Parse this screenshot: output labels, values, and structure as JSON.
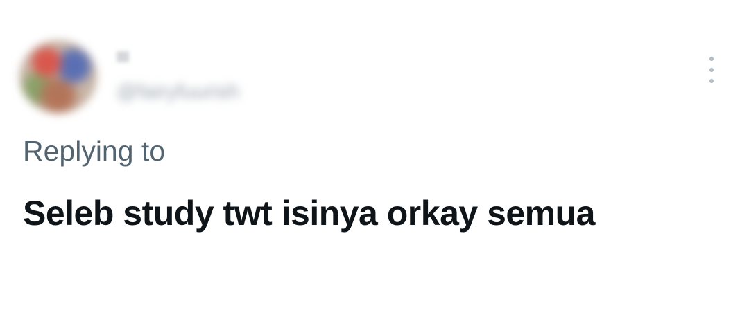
{
  "user": {
    "display_name": "",
    "handle": "@fairyfuurish"
  },
  "icons": {
    "avatar": "profile-avatar",
    "more": "more-vertical-icon"
  },
  "reply": {
    "label": "Replying to"
  },
  "tweet": {
    "text": "Seleb study twt isinya orkay semua"
  },
  "colors": {
    "text_primary": "#0f1419",
    "text_secondary": "#536471",
    "icon_muted": "#b3bcc5",
    "background": "#ffffff"
  }
}
